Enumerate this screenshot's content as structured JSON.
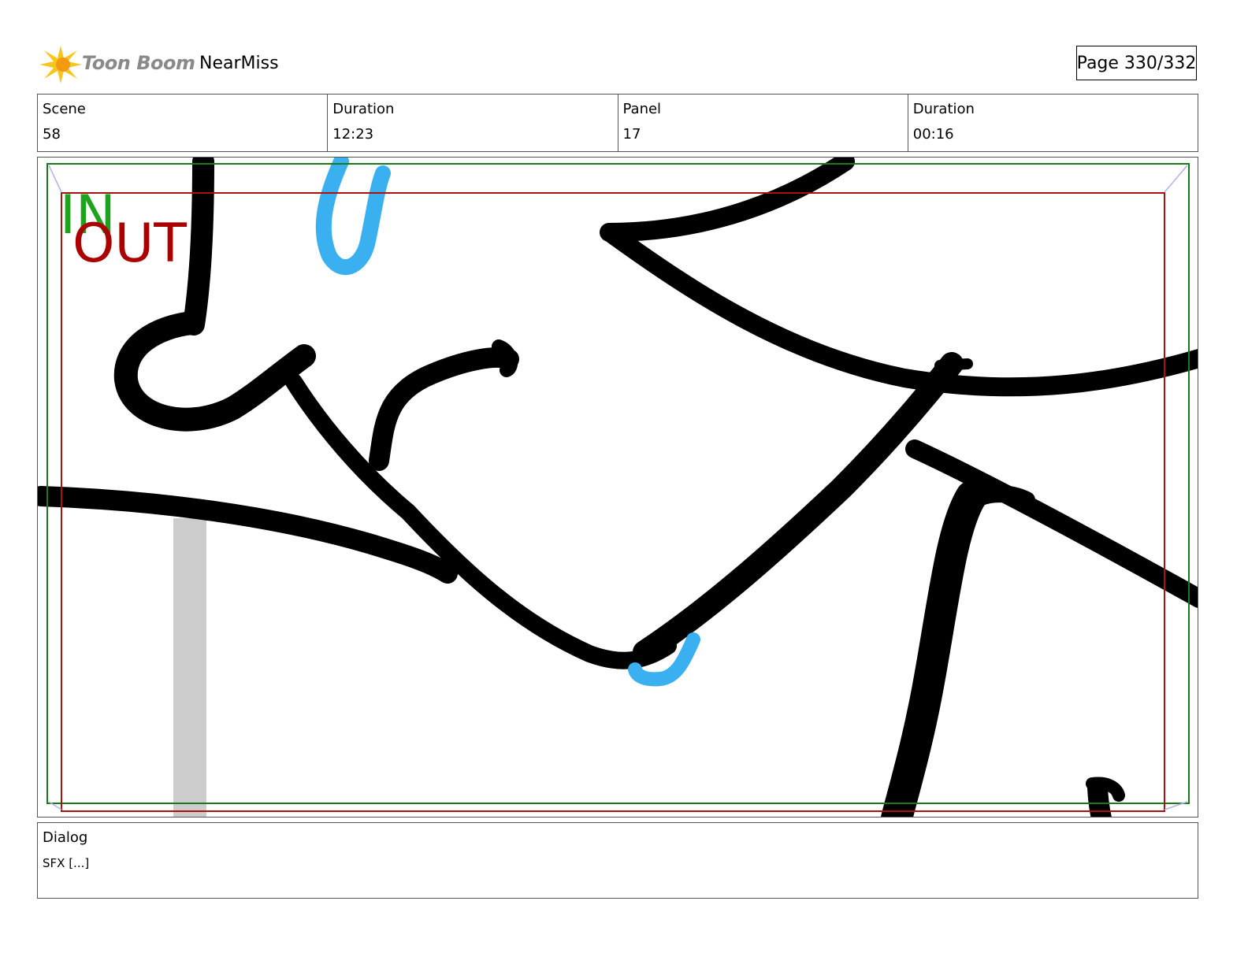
{
  "header": {
    "logo_text": "Toon Boom",
    "project_name": "NearMiss",
    "page_label": "Page 330/332"
  },
  "info": {
    "scene_label": "Scene",
    "scene_value": "58",
    "scene_duration_label": "Duration",
    "scene_duration_value": "12:23",
    "panel_label": "Panel",
    "panel_value": "17",
    "panel_duration_label": "Duration",
    "panel_duration_value": "00:16"
  },
  "panel": {
    "in_label": "IN",
    "out_label": "OUT",
    "colors": {
      "in_frame": "#1a7a1a",
      "out_frame": "#aa1111",
      "in_text": "#1fa31f",
      "out_text": "#aa0000",
      "ink": "#000000",
      "accent_blue": "#3bb0f0",
      "gray_bar": "#cccccc"
    }
  },
  "dialog": {
    "label": "Dialog",
    "text": "SFX [...]"
  }
}
